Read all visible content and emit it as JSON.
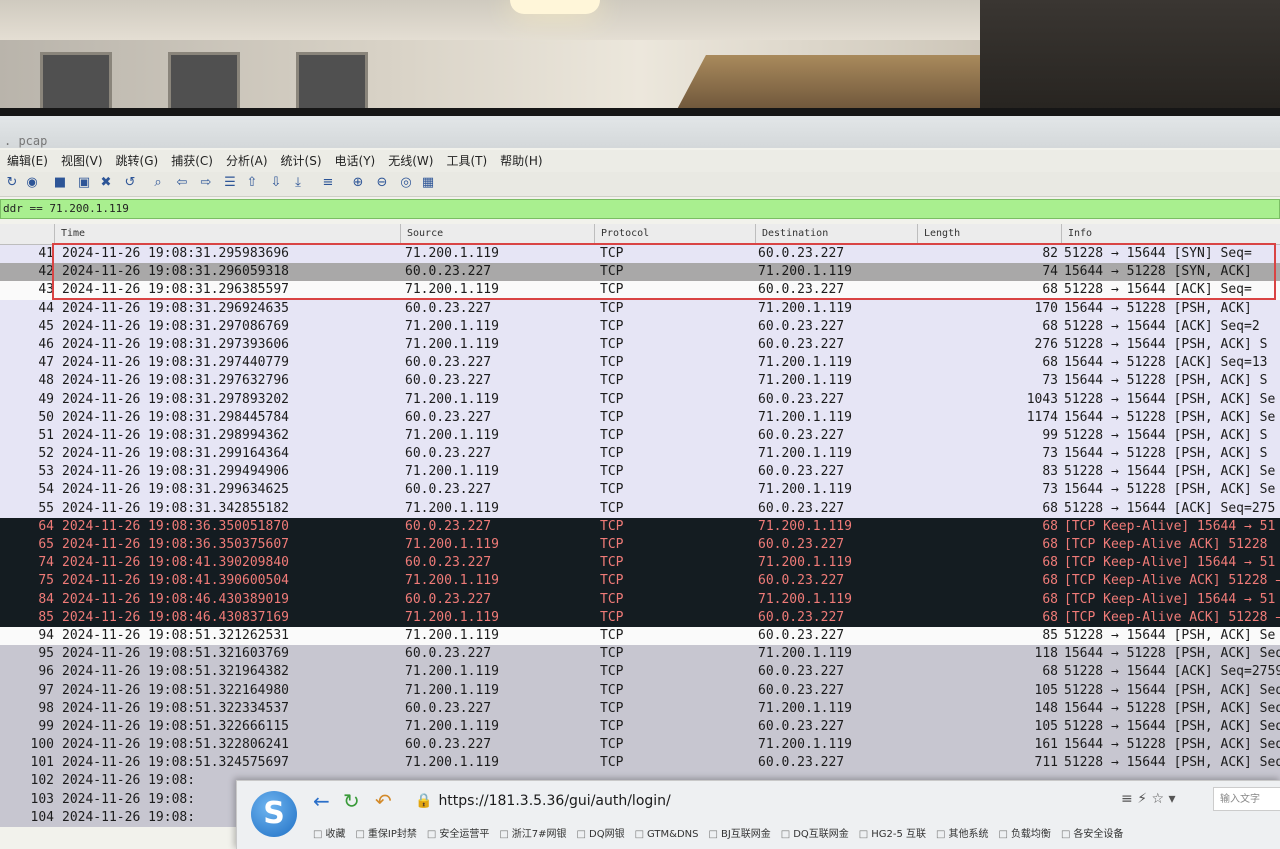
{
  "window": {
    "title": ". pcap"
  },
  "menu": [
    "编辑(E)",
    "视图(V)",
    "跳转(G)",
    "捕获(C)",
    "分析(A)",
    "统计(S)",
    "电话(Y)",
    "无线(W)",
    "工具(T)",
    "帮助(H)"
  ],
  "toolbar_icons": [
    "reload-icon",
    "options-icon",
    "open-icon",
    "save-icon",
    "close-file-icon",
    "reload-file-icon",
    "find-icon",
    "back-icon",
    "forward-icon",
    "goto-icon",
    "first-icon",
    "last-icon",
    "autoscroll-icon",
    "colorize-icon",
    "zoom-in-icon",
    "zoom-out-icon",
    "zoom-reset-icon",
    "resize-columns-icon"
  ],
  "filter": {
    "value": "ddr == 71.200.1.119"
  },
  "columns": {
    "time": "Time",
    "source": "Source",
    "protocol": "Protocol",
    "destination": "Destination",
    "length": "Length",
    "info": "Info"
  },
  "packets": [
    {
      "no": "41",
      "time": "2024-11-26 19:08:31.295983696",
      "src": "71.200.1.119",
      "proto": "TCP",
      "dst": "60.0.23.227",
      "len": "82",
      "info": "51228 → 15644 [SYN] Seq=",
      "style": "light"
    },
    {
      "no": "42",
      "time": "2024-11-26 19:08:31.296059318",
      "src": "60.0.23.227",
      "proto": "TCP",
      "dst": "71.200.1.119",
      "len": "74",
      "info": "15644 → 51228 [SYN, ACK]",
      "style": "gray"
    },
    {
      "no": "43",
      "time": "2024-11-26 19:08:31.296385597",
      "src": "71.200.1.119",
      "proto": "TCP",
      "dst": "60.0.23.227",
      "len": "68",
      "info": "51228 → 15644 [ACK] Seq=",
      "style": "white"
    },
    {
      "no": "44",
      "time": "2024-11-26 19:08:31.296924635",
      "src": "60.0.23.227",
      "proto": "TCP",
      "dst": "71.200.1.119",
      "len": "170",
      "info": "15644 → 51228 [PSH, ACK]",
      "style": "light"
    },
    {
      "no": "45",
      "time": "2024-11-26 19:08:31.297086769",
      "src": "71.200.1.119",
      "proto": "TCP",
      "dst": "60.0.23.227",
      "len": "68",
      "info": "51228 → 15644 [ACK] Seq=2",
      "style": "light"
    },
    {
      "no": "46",
      "time": "2024-11-26 19:08:31.297393606",
      "src": "71.200.1.119",
      "proto": "TCP",
      "dst": "60.0.23.227",
      "len": "276",
      "info": "51228 → 15644 [PSH, ACK] S",
      "style": "light"
    },
    {
      "no": "47",
      "time": "2024-11-26 19:08:31.297440779",
      "src": "60.0.23.227",
      "proto": "TCP",
      "dst": "71.200.1.119",
      "len": "68",
      "info": "15644 → 51228 [ACK] Seq=13",
      "style": "light"
    },
    {
      "no": "48",
      "time": "2024-11-26 19:08:31.297632796",
      "src": "60.0.23.227",
      "proto": "TCP",
      "dst": "71.200.1.119",
      "len": "73",
      "info": "15644 → 51228 [PSH, ACK] S",
      "style": "light"
    },
    {
      "no": "49",
      "time": "2024-11-26 19:08:31.297893202",
      "src": "71.200.1.119",
      "proto": "TCP",
      "dst": "60.0.23.227",
      "len": "1043",
      "info": "51228 → 15644 [PSH, ACK] Se",
      "style": "light"
    },
    {
      "no": "50",
      "time": "2024-11-26 19:08:31.298445784",
      "src": "60.0.23.227",
      "proto": "TCP",
      "dst": "71.200.1.119",
      "len": "1174",
      "info": "15644 → 51228 [PSH, ACK] Se",
      "style": "light"
    },
    {
      "no": "51",
      "time": "2024-11-26 19:08:31.298994362",
      "src": "71.200.1.119",
      "proto": "TCP",
      "dst": "60.0.23.227",
      "len": "99",
      "info": "51228 → 15644 [PSH, ACK] S",
      "style": "light"
    },
    {
      "no": "52",
      "time": "2024-11-26 19:08:31.299164364",
      "src": "60.0.23.227",
      "proto": "TCP",
      "dst": "71.200.1.119",
      "len": "73",
      "info": "15644 → 51228 [PSH, ACK] S",
      "style": "light"
    },
    {
      "no": "53",
      "time": "2024-11-26 19:08:31.299494906",
      "src": "71.200.1.119",
      "proto": "TCP",
      "dst": "60.0.23.227",
      "len": "83",
      "info": "51228 → 15644 [PSH, ACK] Se",
      "style": "light"
    },
    {
      "no": "54",
      "time": "2024-11-26 19:08:31.299634625",
      "src": "60.0.23.227",
      "proto": "TCP",
      "dst": "71.200.1.119",
      "len": "73",
      "info": "15644 → 51228 [PSH, ACK] Se",
      "style": "light"
    },
    {
      "no": "55",
      "time": "2024-11-26 19:08:31.342855182",
      "src": "71.200.1.119",
      "proto": "TCP",
      "dst": "60.0.23.227",
      "len": "68",
      "info": "51228 → 15644 [ACK] Seq=275",
      "style": "light"
    },
    {
      "no": "64",
      "time": "2024-11-26 19:08:36.350051870",
      "src": "60.0.23.227",
      "proto": "TCP",
      "dst": "71.200.1.119",
      "len": "68",
      "info": "[TCP Keep-Alive] 15644 → 51",
      "style": "dark"
    },
    {
      "no": "65",
      "time": "2024-11-26 19:08:36.350375607",
      "src": "71.200.1.119",
      "proto": "TCP",
      "dst": "60.0.23.227",
      "len": "68",
      "info": "[TCP Keep-Alive ACK] 51228",
      "style": "dark"
    },
    {
      "no": "74",
      "time": "2024-11-26 19:08:41.390209840",
      "src": "60.0.23.227",
      "proto": "TCP",
      "dst": "71.200.1.119",
      "len": "68",
      "info": "[TCP Keep-Alive] 15644 → 51",
      "style": "dark"
    },
    {
      "no": "75",
      "time": "2024-11-26 19:08:41.390600504",
      "src": "71.200.1.119",
      "proto": "TCP",
      "dst": "60.0.23.227",
      "len": "68",
      "info": "[TCP Keep-Alive ACK] 51228 →",
      "style": "dark"
    },
    {
      "no": "84",
      "time": "2024-11-26 19:08:46.430389019",
      "src": "60.0.23.227",
      "proto": "TCP",
      "dst": "71.200.1.119",
      "len": "68",
      "info": "[TCP Keep-Alive] 15644 → 51",
      "style": "dark"
    },
    {
      "no": "85",
      "time": "2024-11-26 19:08:46.430837169",
      "src": "71.200.1.119",
      "proto": "TCP",
      "dst": "60.0.23.227",
      "len": "68",
      "info": "[TCP Keep-Alive ACK] 51228 →",
      "style": "dark"
    },
    {
      "no": "94",
      "time": "2024-11-26 19:08:51.321262531",
      "src": "71.200.1.119",
      "proto": "TCP",
      "dst": "60.0.23.227",
      "len": "85",
      "info": "51228 → 15644 [PSH, ACK] Se",
      "style": "white"
    },
    {
      "no": "95",
      "time": "2024-11-26 19:08:51.321603769",
      "src": "60.0.23.227",
      "proto": "TCP",
      "dst": "71.200.1.119",
      "len": "118",
      "info": "15644 → 51228 [PSH, ACK] Seq",
      "style": "lower"
    },
    {
      "no": "96",
      "time": "2024-11-26 19:08:51.321964382",
      "src": "71.200.1.119",
      "proto": "TCP",
      "dst": "60.0.23.227",
      "len": "68",
      "info": "51228 → 15644 [ACK] Seq=2759",
      "style": "lower"
    },
    {
      "no": "97",
      "time": "2024-11-26 19:08:51.322164980",
      "src": "71.200.1.119",
      "proto": "TCP",
      "dst": "60.0.23.227",
      "len": "105",
      "info": "51228 → 15644 [PSH, ACK] Seq",
      "style": "lower"
    },
    {
      "no": "98",
      "time": "2024-11-26 19:08:51.322334537",
      "src": "60.0.23.227",
      "proto": "TCP",
      "dst": "71.200.1.119",
      "len": "148",
      "info": "15644 → 51228 [PSH, ACK] Seq",
      "style": "lower"
    },
    {
      "no": "99",
      "time": "2024-11-26 19:08:51.322666115",
      "src": "71.200.1.119",
      "proto": "TCP",
      "dst": "60.0.23.227",
      "len": "105",
      "info": "51228 → 15644 [PSH, ACK] Seq",
      "style": "lower"
    },
    {
      "no": "100",
      "time": "2024-11-26 19:08:51.322806241",
      "src": "60.0.23.227",
      "proto": "TCP",
      "dst": "71.200.1.119",
      "len": "161",
      "info": "15644 → 51228 [PSH, ACK] Seq",
      "style": "lower"
    },
    {
      "no": "101",
      "time": "2024-11-26 19:08:51.324575697",
      "src": "71.200.1.119",
      "proto": "TCP",
      "dst": "60.0.23.227",
      "len": "711",
      "info": "51228 → 15644 [PSH, ACK] Seq",
      "style": "lower"
    },
    {
      "no": "102",
      "time": "2024-11-26 19:08:",
      "src": "",
      "proto": "",
      "dst": "",
      "len": "",
      "info": "",
      "style": "lower"
    },
    {
      "no": "103",
      "time": "2024-11-26 19:08:",
      "src": "",
      "proto": "",
      "dst": "",
      "len": "",
      "info": "",
      "style": "lower"
    },
    {
      "no": "104",
      "time": "2024-11-26 19:08:",
      "src": "",
      "proto": "",
      "dst": "",
      "len": "",
      "info": "",
      "style": "lower"
    }
  ],
  "browser": {
    "url": "https://181.3.5.36/gui/auth/login/",
    "search_placeholder": "输入文字",
    "bookmarks": [
      "收藏",
      "重保IP封禁",
      "安全运营平",
      "浙江7#网银",
      "DQ网银",
      "GTM&DNS",
      "BJ互联网金",
      "DQ互联网金",
      "HG2-5 互联",
      "其他系统",
      "负载均衡",
      "各安全设备"
    ]
  },
  "colors": {
    "filter_bg": "#a9ef8f",
    "keepalive_bg": "#141c21",
    "keepalive_fg": "#f07b78",
    "highlight_box": "#d94444"
  }
}
